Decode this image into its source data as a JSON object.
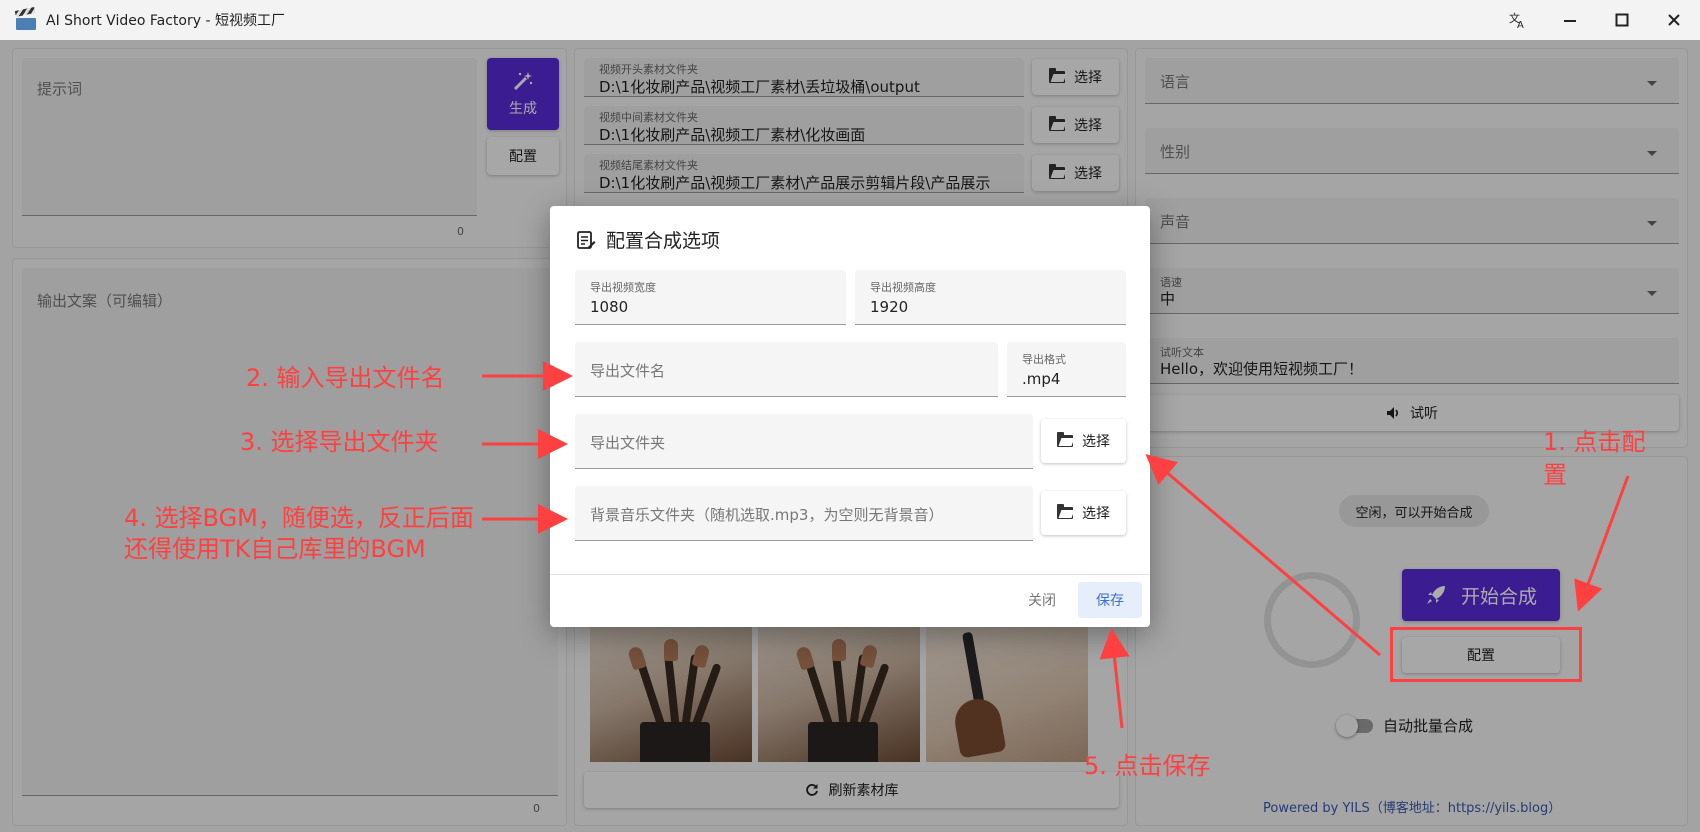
{
  "window": {
    "title": "AI Short Video Factory - 短视频工厂"
  },
  "left": {
    "prompt_placeholder": "提示词",
    "prompt_count": "0",
    "generate_label": "生成",
    "config_label": "配置",
    "output_label": "输出文案（可编辑）",
    "output_count": "0"
  },
  "middle": {
    "folders": [
      {
        "label": "视频开头素材文件夹",
        "value": "D:\\1化妆刷产品\\视频工厂素材\\丢垃圾桶\\output",
        "button": "选择"
      },
      {
        "label": "视频中间素材文件夹",
        "value": "D:\\1化妆刷产品\\视频工厂素材\\化妆画面",
        "button": "选择"
      },
      {
        "label": "视频结尾素材文件夹",
        "value": "D:\\1化妆刷产品\\视频工厂素材\\产品展示剪辑片段\\产品展示",
        "button": "选择"
      }
    ],
    "refresh_label": "刷新素材库"
  },
  "right": {
    "language_label": "语言",
    "gender_label": "性别",
    "voice_label": "声音",
    "speed_label": "语速",
    "speed_value": "中",
    "preview_label": "试听文本",
    "preview_value": "Hello，欢迎使用短视频工厂！",
    "listen_label": "试听",
    "status_text": "空闲，可以开始合成",
    "start_label": "开始合成",
    "config_label": "配置",
    "auto_batch_label": "自动批量合成",
    "footer": "Powered by YILS（博客地址：https://yils.blog）"
  },
  "dialog": {
    "title": "配置合成选项",
    "width_label": "导出视频宽度",
    "width_value": "1080",
    "height_label": "导出视频高度",
    "height_value": "1920",
    "filename_placeholder": "导出文件名",
    "format_label": "导出格式",
    "format_value": ".mp4",
    "folder_placeholder": "导出文件夹",
    "folder_button": "选择",
    "bgm_placeholder": "背景音乐文件夹（随机选取.mp3，为空则无背景音）",
    "bgm_button": "选择",
    "close_label": "关闭",
    "save_label": "保存"
  },
  "annotations": {
    "step1": "1. 点击配置",
    "step2": "2. 输入导出文件名",
    "step3": "3. 选择导出文件夹",
    "step4_line1": "4. 选择BGM，随便选，反正后面",
    "step4_line2": "还得使用TK自己库里的BGM",
    "step5": "5. 点击保存"
  },
  "colors": {
    "primary": "#5a2bd8",
    "annotation": "#ff4040",
    "footer_link": "#3a59b0"
  }
}
